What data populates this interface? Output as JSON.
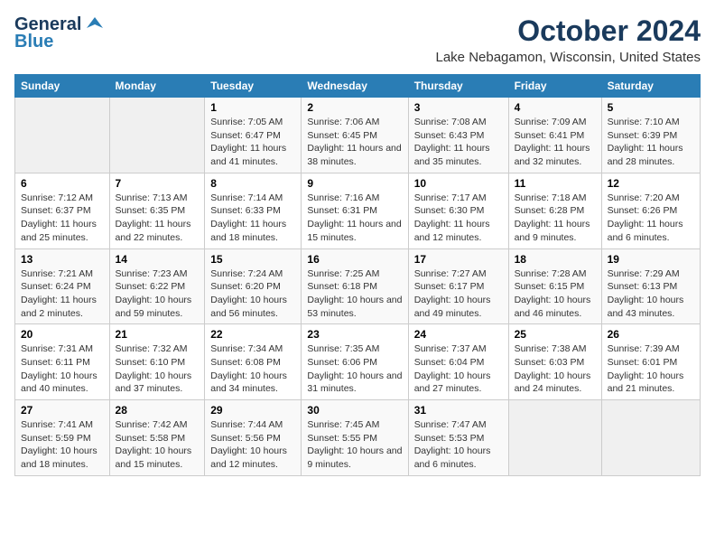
{
  "header": {
    "logo_line1": "General",
    "logo_line2": "Blue",
    "title": "October 2024",
    "subtitle": "Lake Nebagamon, Wisconsin, United States"
  },
  "days_of_week": [
    "Sunday",
    "Monday",
    "Tuesday",
    "Wednesday",
    "Thursday",
    "Friday",
    "Saturday"
  ],
  "weeks": [
    [
      {
        "day": "",
        "info": ""
      },
      {
        "day": "",
        "info": ""
      },
      {
        "day": "1",
        "info": "Sunrise: 7:05 AM\nSunset: 6:47 PM\nDaylight: 11 hours and 41 minutes."
      },
      {
        "day": "2",
        "info": "Sunrise: 7:06 AM\nSunset: 6:45 PM\nDaylight: 11 hours and 38 minutes."
      },
      {
        "day": "3",
        "info": "Sunrise: 7:08 AM\nSunset: 6:43 PM\nDaylight: 11 hours and 35 minutes."
      },
      {
        "day": "4",
        "info": "Sunrise: 7:09 AM\nSunset: 6:41 PM\nDaylight: 11 hours and 32 minutes."
      },
      {
        "day": "5",
        "info": "Sunrise: 7:10 AM\nSunset: 6:39 PM\nDaylight: 11 hours and 28 minutes."
      }
    ],
    [
      {
        "day": "6",
        "info": "Sunrise: 7:12 AM\nSunset: 6:37 PM\nDaylight: 11 hours and 25 minutes."
      },
      {
        "day": "7",
        "info": "Sunrise: 7:13 AM\nSunset: 6:35 PM\nDaylight: 11 hours and 22 minutes."
      },
      {
        "day": "8",
        "info": "Sunrise: 7:14 AM\nSunset: 6:33 PM\nDaylight: 11 hours and 18 minutes."
      },
      {
        "day": "9",
        "info": "Sunrise: 7:16 AM\nSunset: 6:31 PM\nDaylight: 11 hours and 15 minutes."
      },
      {
        "day": "10",
        "info": "Sunrise: 7:17 AM\nSunset: 6:30 PM\nDaylight: 11 hours and 12 minutes."
      },
      {
        "day": "11",
        "info": "Sunrise: 7:18 AM\nSunset: 6:28 PM\nDaylight: 11 hours and 9 minutes."
      },
      {
        "day": "12",
        "info": "Sunrise: 7:20 AM\nSunset: 6:26 PM\nDaylight: 11 hours and 6 minutes."
      }
    ],
    [
      {
        "day": "13",
        "info": "Sunrise: 7:21 AM\nSunset: 6:24 PM\nDaylight: 11 hours and 2 minutes."
      },
      {
        "day": "14",
        "info": "Sunrise: 7:23 AM\nSunset: 6:22 PM\nDaylight: 10 hours and 59 minutes."
      },
      {
        "day": "15",
        "info": "Sunrise: 7:24 AM\nSunset: 6:20 PM\nDaylight: 10 hours and 56 minutes."
      },
      {
        "day": "16",
        "info": "Sunrise: 7:25 AM\nSunset: 6:18 PM\nDaylight: 10 hours and 53 minutes."
      },
      {
        "day": "17",
        "info": "Sunrise: 7:27 AM\nSunset: 6:17 PM\nDaylight: 10 hours and 49 minutes."
      },
      {
        "day": "18",
        "info": "Sunrise: 7:28 AM\nSunset: 6:15 PM\nDaylight: 10 hours and 46 minutes."
      },
      {
        "day": "19",
        "info": "Sunrise: 7:29 AM\nSunset: 6:13 PM\nDaylight: 10 hours and 43 minutes."
      }
    ],
    [
      {
        "day": "20",
        "info": "Sunrise: 7:31 AM\nSunset: 6:11 PM\nDaylight: 10 hours and 40 minutes."
      },
      {
        "day": "21",
        "info": "Sunrise: 7:32 AM\nSunset: 6:10 PM\nDaylight: 10 hours and 37 minutes."
      },
      {
        "day": "22",
        "info": "Sunrise: 7:34 AM\nSunset: 6:08 PM\nDaylight: 10 hours and 34 minutes."
      },
      {
        "day": "23",
        "info": "Sunrise: 7:35 AM\nSunset: 6:06 PM\nDaylight: 10 hours and 31 minutes."
      },
      {
        "day": "24",
        "info": "Sunrise: 7:37 AM\nSunset: 6:04 PM\nDaylight: 10 hours and 27 minutes."
      },
      {
        "day": "25",
        "info": "Sunrise: 7:38 AM\nSunset: 6:03 PM\nDaylight: 10 hours and 24 minutes."
      },
      {
        "day": "26",
        "info": "Sunrise: 7:39 AM\nSunset: 6:01 PM\nDaylight: 10 hours and 21 minutes."
      }
    ],
    [
      {
        "day": "27",
        "info": "Sunrise: 7:41 AM\nSunset: 5:59 PM\nDaylight: 10 hours and 18 minutes."
      },
      {
        "day": "28",
        "info": "Sunrise: 7:42 AM\nSunset: 5:58 PM\nDaylight: 10 hours and 15 minutes."
      },
      {
        "day": "29",
        "info": "Sunrise: 7:44 AM\nSunset: 5:56 PM\nDaylight: 10 hours and 12 minutes."
      },
      {
        "day": "30",
        "info": "Sunrise: 7:45 AM\nSunset: 5:55 PM\nDaylight: 10 hours and 9 minutes."
      },
      {
        "day": "31",
        "info": "Sunrise: 7:47 AM\nSunset: 5:53 PM\nDaylight: 10 hours and 6 minutes."
      },
      {
        "day": "",
        "info": ""
      },
      {
        "day": "",
        "info": ""
      }
    ]
  ]
}
